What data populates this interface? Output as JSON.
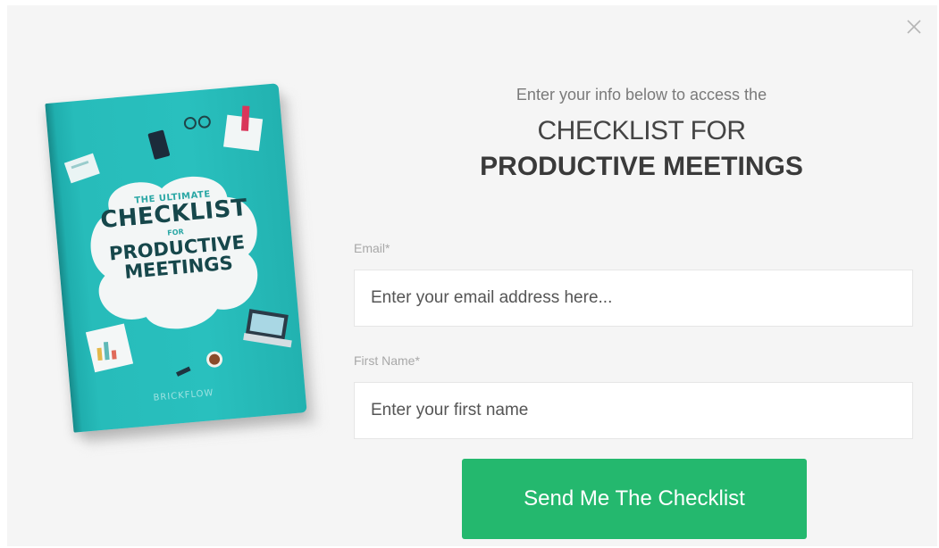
{
  "close_icon": "close-icon",
  "book": {
    "kicker": "THE ULTIMATE",
    "title_big": "CHECKLIST",
    "title_for": "FOR",
    "title_line3": "PRODUCTIVE",
    "title_line4": "MEETINGS",
    "brand": "BRICKFLOW",
    "cover_color": "#29c0be"
  },
  "header": {
    "intro": "Enter your info below to access the",
    "title_line1": "CHECKLIST FOR",
    "title_line2": "PRODUCTIVE MEETINGS"
  },
  "form": {
    "email_label": "Email*",
    "email_placeholder": "Enter your email address here...",
    "email_value": "",
    "first_name_label": "First Name*",
    "first_name_placeholder": "Enter your first name",
    "first_name_value": "",
    "submit_label": "Send Me The Checklist",
    "submit_color": "#24b86e"
  }
}
